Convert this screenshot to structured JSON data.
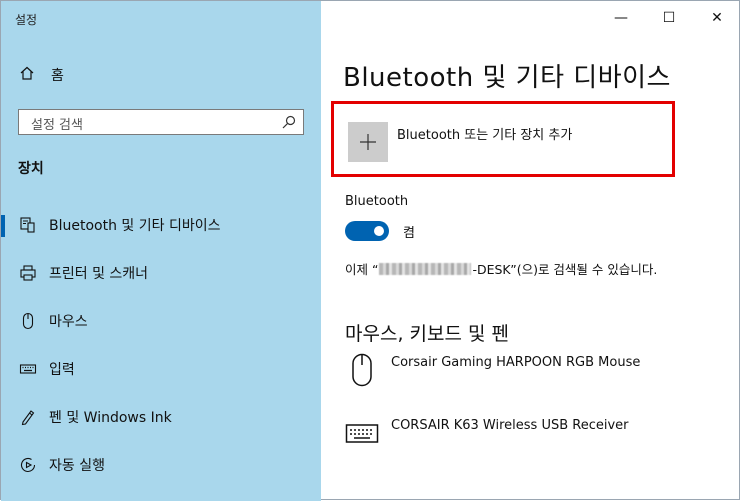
{
  "app": {
    "title": "설정"
  },
  "sidebar": {
    "home_label": "홈",
    "search_placeholder": "설정 검색",
    "section_label": "장치",
    "items": [
      {
        "label": "Bluetooth 및 기타 디바이스",
        "icon": "bluetooth-device-icon",
        "active": true
      },
      {
        "label": "프린터 및 스캐너",
        "icon": "printer-icon"
      },
      {
        "label": "마우스",
        "icon": "mouse-icon"
      },
      {
        "label": "입력",
        "icon": "keyboard-icon"
      },
      {
        "label": "펜 및 Windows Ink",
        "icon": "pen-icon"
      },
      {
        "label": "자동 실행",
        "icon": "autoplay-icon"
      }
    ]
  },
  "window_controls": {
    "minimize": "—",
    "maximize": "☐",
    "close": "✕"
  },
  "main": {
    "title": "Bluetooth 및 기타 디바이스",
    "add_device_label": "Bluetooth 또는 기타 장치 추가",
    "bluetooth_label": "Bluetooth",
    "toggle_state": "켬",
    "discover_prefix": "이제 “",
    "discover_suffix": "-DESK”(으)로 검색될 수 있습니다.",
    "section2_title": "마우스, 키보드 및 펜",
    "devices": [
      {
        "name": "Corsair Gaming HARPOON RGB Mouse",
        "icon": "mouse-icon"
      },
      {
        "name": "CORSAIR K63 Wireless USB Receiver",
        "icon": "keyboard-icon"
      }
    ]
  },
  "colors": {
    "sidebar_bg": "#a9d7ec",
    "accent": "#0063b1",
    "highlight_border": "#e30000"
  }
}
